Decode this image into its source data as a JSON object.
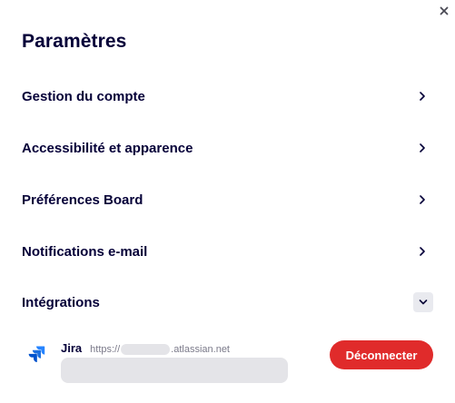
{
  "panel": {
    "title": "Paramètres",
    "close_icon": "close-icon"
  },
  "settings_items": [
    {
      "label": "Gestion du compte",
      "icon": "chevron-right-icon"
    },
    {
      "label": "Accessibilité et apparence",
      "icon": "chevron-right-icon"
    },
    {
      "label": "Préférences Board",
      "icon": "chevron-right-icon"
    },
    {
      "label": "Notifications e-mail",
      "icon": "chevron-right-icon"
    },
    {
      "label": "Intégrations",
      "icon": "chevron-down-icon",
      "expanded": true
    }
  ],
  "integrations": [
    {
      "name": "Jira",
      "url_prefix": "https://",
      "url_suffix": ".atlassian.net",
      "action_label": "Déconnecter",
      "icon": "jira-icon"
    }
  ],
  "colors": {
    "text": "#050038",
    "muted": "#7b7a8a",
    "danger": "#e02b2b",
    "jira_blue": "#2684ff"
  }
}
